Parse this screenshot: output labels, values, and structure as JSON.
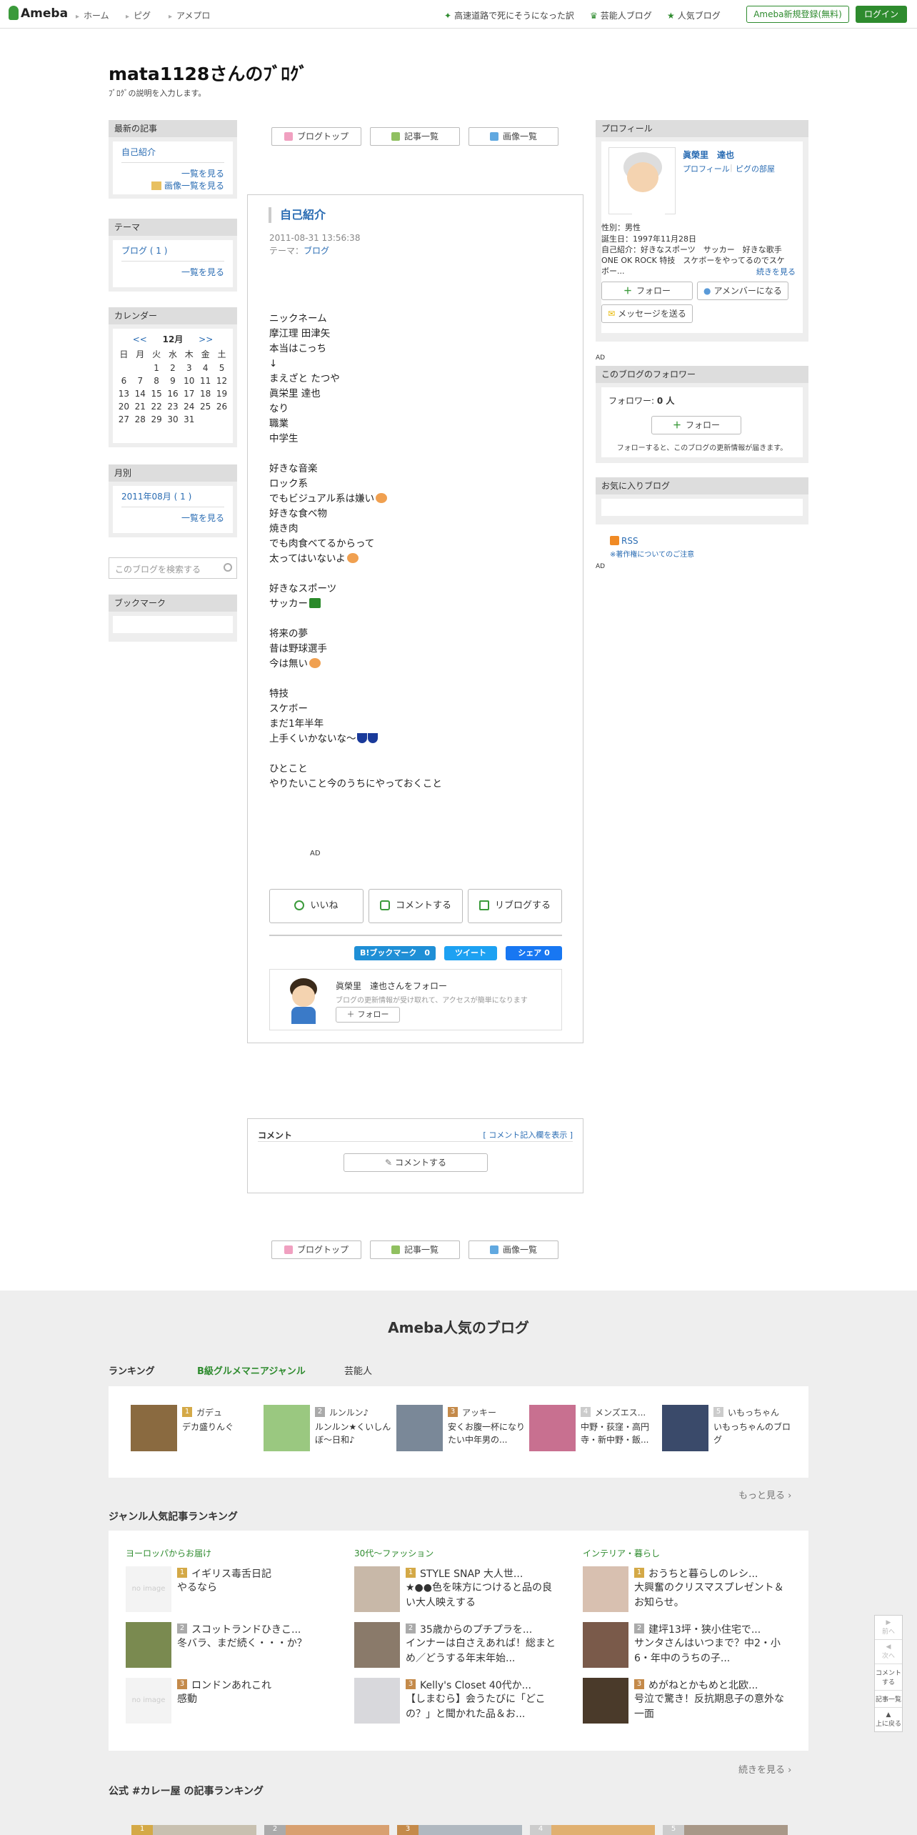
{
  "topbar": {
    "logo": "Ameba",
    "nav": [
      "ホーム",
      "ピグ",
      "アメプロ"
    ],
    "right_links": [
      "高速道路で死にそうになった訳",
      "芸能人ブログ",
      "人気ブログ"
    ],
    "register": "Ameba新規登録(無料)",
    "login": "ログイン"
  },
  "blog": {
    "title": "mata1128さんのﾌﾞﾛｸﾞ",
    "description": "ﾌﾞﾛｸﾞの説明を入力します。"
  },
  "sidebar": {
    "recent": {
      "title": "最新の記事",
      "item": "自己紹介",
      "more": "一覧を見る",
      "images": "画像一覧を見る"
    },
    "theme": {
      "title": "テーマ",
      "item": "ブログ ( 1 )",
      "more": "一覧を見る"
    },
    "calendar": {
      "title": "カレンダー",
      "prev": "<<",
      "month": "12月",
      "next": ">>",
      "weekdays": [
        "日",
        "月",
        "火",
        "水",
        "木",
        "金",
        "土"
      ],
      "weeks": [
        [
          "",
          "",
          "1",
          "2",
          "3",
          "4",
          "5"
        ],
        [
          "6",
          "7",
          "8",
          "9",
          "10",
          "11",
          "12"
        ],
        [
          "13",
          "14",
          "15",
          "16",
          "17",
          "18",
          "19"
        ],
        [
          "20",
          "21",
          "22",
          "23",
          "24",
          "25",
          "26"
        ],
        [
          "27",
          "28",
          "29",
          "30",
          "31",
          "",
          ""
        ]
      ]
    },
    "monthly": {
      "title": "月別",
      "item": "2011年08月 ( 1 )",
      "more": "一覧を見る"
    },
    "search_placeholder": "このブログを検索する",
    "bookmark": {
      "title": "ブックマーク"
    }
  },
  "toolbar": {
    "top": "ブログトップ",
    "list": "記事一覧",
    "images": "画像一覧"
  },
  "article": {
    "title": "自己紹介",
    "date": "2011-08-31 13:56:38",
    "theme_label": "テーマ：",
    "theme": "ブログ",
    "lines": [
      "ニックネーム",
      "摩江理 田津矢",
      "本当はこっち",
      "↓",
      "まえざと たつや",
      "眞栄里 達也",
      "なり",
      "職業",
      "中学生",
      "",
      "好きな音楽",
      "ロック系",
      "でもビジュアル系は嫌い",
      "好きな食べ物",
      "焼き肉",
      "でも肉食べてるからって",
      "太ってはいないよ",
      "",
      "好きなスポーツ",
      "サッカー",
      "",
      "将来の夢",
      "昔は野球選手",
      "今は無い",
      "",
      "特技",
      "スケボー",
      "まだ1年半年",
      "上手くいかないな～",
      "",
      "ひとこと",
      "やりたいこと今のうちにやっておくこと"
    ],
    "ad": "AD",
    "like": "いいね",
    "comment": "コメントする",
    "reblog": "リブログする",
    "hatena": "B!ブックマーク　0",
    "tweet": "ツイート",
    "share": "シェア 0",
    "follow_card": {
      "name": "眞榮里　達也さんをフォロー",
      "desc": "ブログの更新情報が受け取れて、アクセスが簡単になります",
      "button": "フォロー"
    }
  },
  "comments": {
    "title": "コメント",
    "show": "[ コメント記入欄を表示 ]",
    "button": "コメントする"
  },
  "profile": {
    "title": "プロフィール",
    "name": "眞榮里　達也",
    "links": [
      "プロフィール",
      "ピグの部屋"
    ],
    "gender": "性別：男性",
    "birthday": "誕生日：1997年11月28日",
    "intro": "自己紹介：好きなスポーツ　サッカー　好きな歌手　ONE OK ROCK 特技　スケボーをやってるのでスケボー...",
    "more": "続きを見る",
    "follow": "フォロー",
    "amember": "アメンバーになる",
    "message": "メッセージを送る"
  },
  "ad_label": "AD",
  "followers": {
    "title": "このブログのフォロワー",
    "count_label": "フォロワー:",
    "count": "0 人",
    "button": "フォロー",
    "note": "フォローすると、このブログの更新情報が届きます。"
  },
  "favorites": {
    "title": "お気に入りブログ"
  },
  "rss": {
    "label": "RSS",
    "note": "※著作権についてのご注意"
  },
  "footer": {
    "title": "Ameba人気のブログ",
    "ranking_label": "ランキング",
    "tabs": [
      "B級グルメマニアジャンル",
      "芸能人"
    ],
    "ranking": [
      {
        "rank": "1",
        "name": "ガデュ",
        "desc": "デカ盛りんぐ"
      },
      {
        "rank": "2",
        "name": "ルンルン♪",
        "desc": "ルンルン★くいしんぼ～日和♪"
      },
      {
        "rank": "3",
        "name": "アッキー",
        "desc": "安くお腹一杯になりたい中年男の..."
      },
      {
        "rank": "4",
        "name": "メンズエス...",
        "desc": "中野・荻窪・高円寺・新中野・飯..."
      },
      {
        "rank": "5",
        "name": "いもっちゃん",
        "desc": "いもっちゃんのブログ"
      }
    ],
    "more": "もっと見る",
    "genre_title": "ジャンル人気記事ランキング",
    "genres": [
      {
        "cat": "ヨーロッパからお届け",
        "items": [
          {
            "rank": "1",
            "t": "イギリス毒舌日記",
            "d": "やるなら",
            "img": "no image"
          },
          {
            "rank": "2",
            "t": "スコットランドひきこ...",
            "d": "冬バラ、まだ続く・・・か？",
            "img": ""
          },
          {
            "rank": "3",
            "t": "ロンドンあれこれ",
            "d": "感動",
            "img": "no image"
          }
        ]
      },
      {
        "cat": "30代〜ファッション",
        "items": [
          {
            "rank": "1",
            "t": "STYLE SNAP 大人世...",
            "d": "★●●色を味方につけると品の良い大人映えする",
            "img": ""
          },
          {
            "rank": "2",
            "t": "35歳からのプチプラを...",
            "d": "インナーは白さえあれば！総まとめ／どうする年末年始...",
            "img": ""
          },
          {
            "rank": "3",
            "t": "Kelly's Closet 40代か...",
            "d": "【しまむら】会うたびに「どこの？」と聞かれた品＆お...",
            "img": ""
          }
        ]
      },
      {
        "cat": "インテリア・暮らし",
        "items": [
          {
            "rank": "1",
            "t": "おうちと暮らしのレシ...",
            "d": "大興奮のクリスマスプレゼント＆お知らせ。",
            "img": ""
          },
          {
            "rank": "2",
            "t": "建坪13坪・狭小住宅で...",
            "d": "サンタさんはいつまで？中2・小6・年中のうちの子...",
            "img": ""
          },
          {
            "rank": "3",
            "t": "めがねとかもめと北欧...",
            "d": "号泣で驚き！反抗期息子の意外な一面",
            "img": ""
          }
        ]
      }
    ],
    "continue": "続きを見る",
    "official_title": "公式 #カレー屋 の記事ランキング"
  },
  "floatnav": {
    "prev": "前へ",
    "next": "次へ",
    "comment": "コメントする",
    "list": "記事一覧",
    "top": "上に戻る"
  },
  "colors": {
    "accent": "#2e8b2e",
    "link": "#2a6cb3",
    "gold": "#d4a947",
    "silver": "#aaaaaa",
    "bronze": "#c48a4a"
  }
}
